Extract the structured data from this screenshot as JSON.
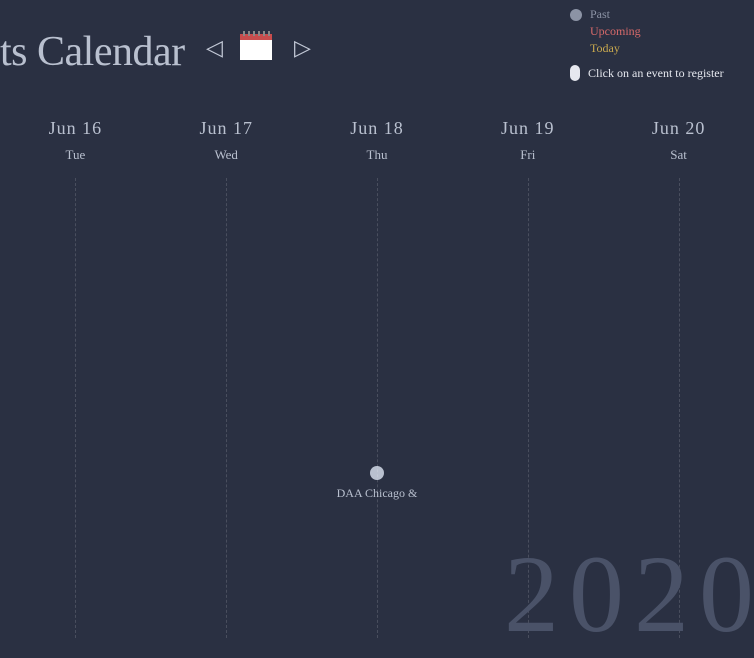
{
  "header": {
    "title": "ts Calendar"
  },
  "legend": {
    "past": {
      "label": "Past",
      "color": "#8c93a5"
    },
    "upcoming": {
      "label": "Upcoming",
      "color": "#d86a6a"
    },
    "today": {
      "label": "Today",
      "color": "#c8a84e"
    },
    "register": "Click on an event to register"
  },
  "year": "2020",
  "columns": [
    {
      "date": "Jun 16",
      "dow": "Tue"
    },
    {
      "date": "Jun 17",
      "dow": "Wed"
    },
    {
      "date": "Jun 18",
      "dow": "Thu"
    },
    {
      "date": "Jun 19",
      "dow": "Fri"
    },
    {
      "date": "Jun 20",
      "dow": "Sat"
    }
  ],
  "event": {
    "label": "DAA Chicago &",
    "column": 2,
    "color": "#b9c0cf"
  }
}
